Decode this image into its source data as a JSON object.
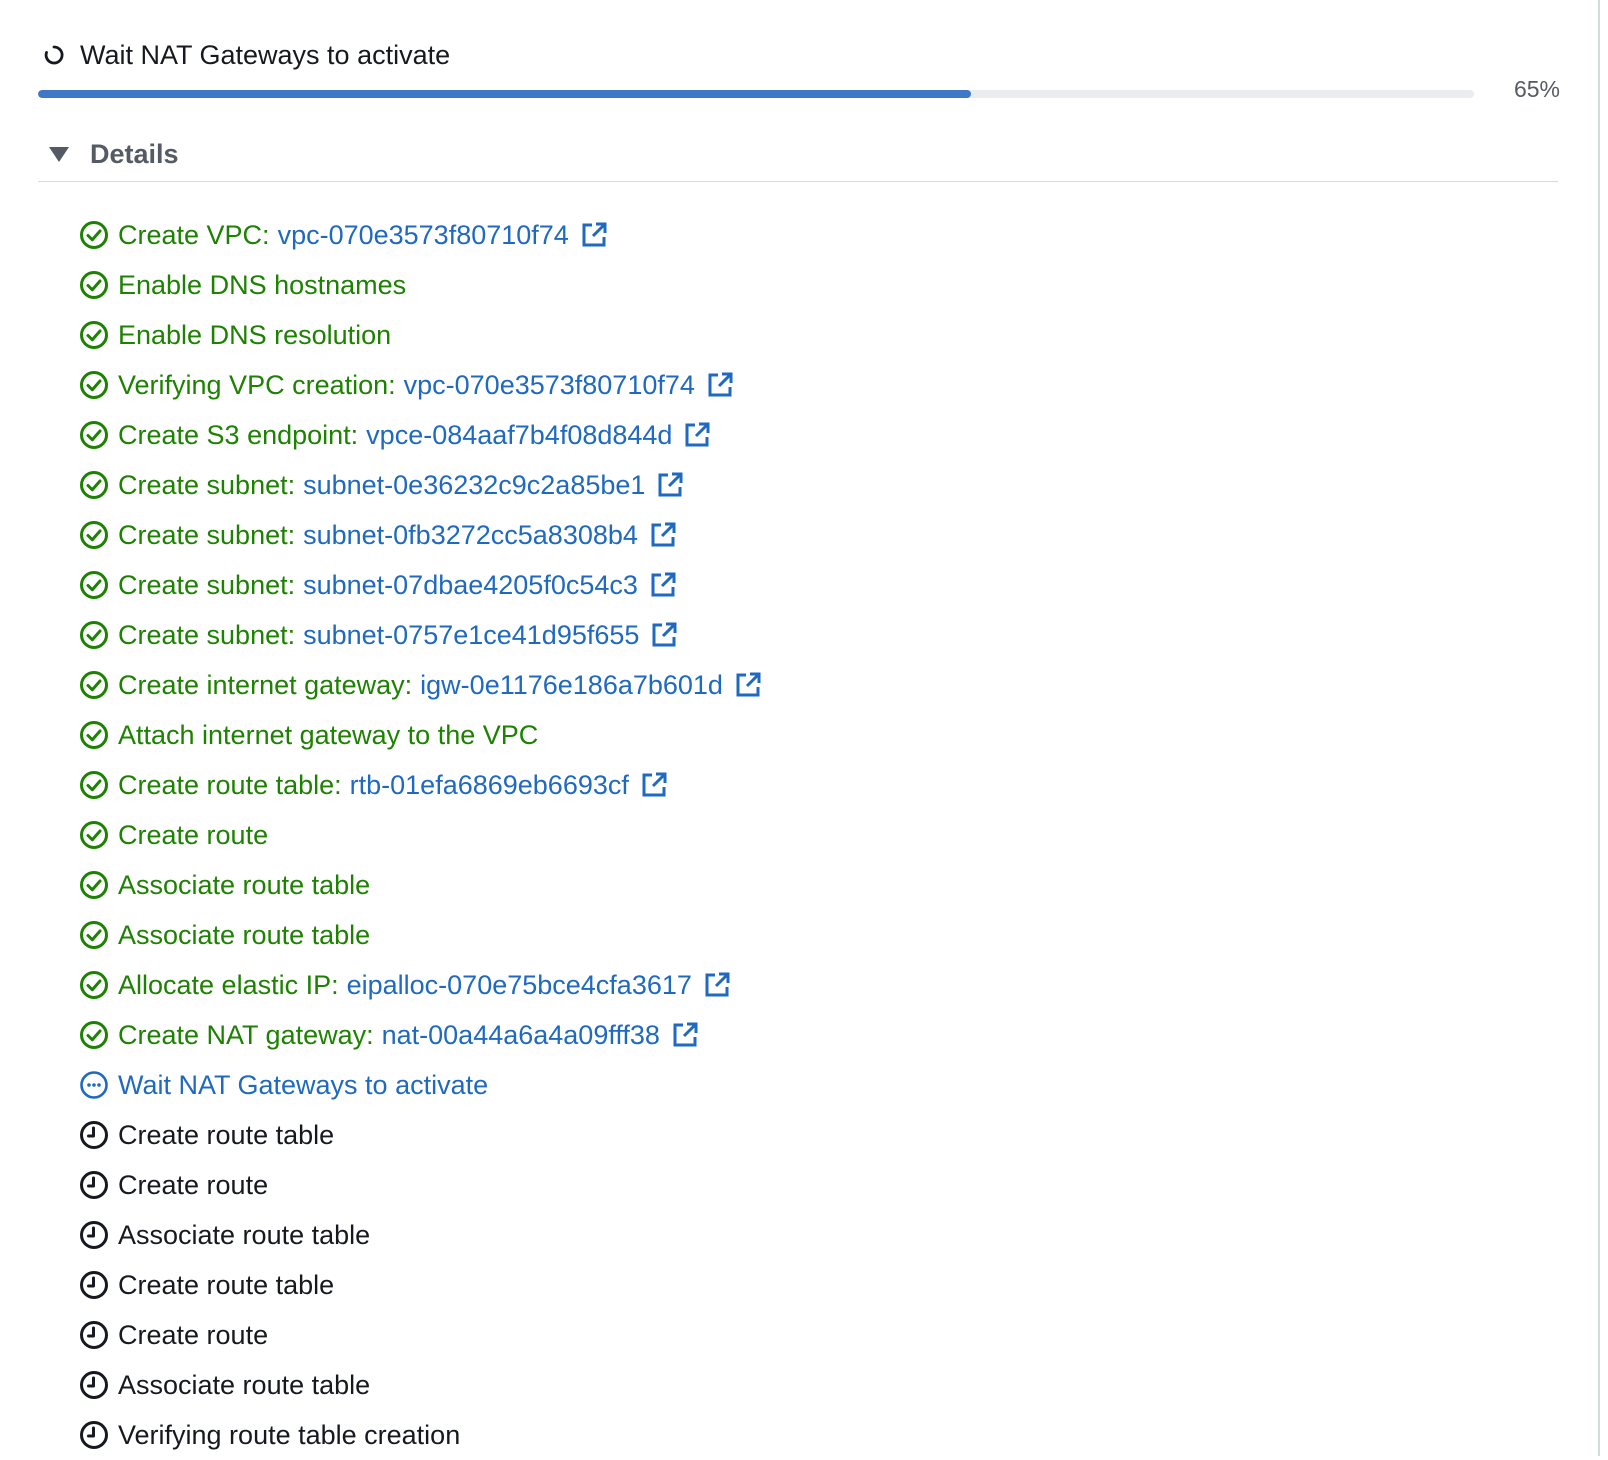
{
  "header": {
    "title": "Wait NAT Gateways to activate",
    "progress_percent": 65,
    "progress_label": "65%"
  },
  "details": {
    "label": "Details",
    "expanded": true
  },
  "colors": {
    "success": "#1d8102",
    "link": "#1f69c1",
    "pending": "#16191f",
    "progress_fill": "#3f78c4",
    "progress_track": "#eaeded"
  },
  "steps": [
    {
      "status": "success",
      "label": "Create VPC:",
      "link": "vpc-070e3573f80710f74"
    },
    {
      "status": "success",
      "label": "Enable DNS hostnames",
      "link": ""
    },
    {
      "status": "success",
      "label": "Enable DNS resolution",
      "link": ""
    },
    {
      "status": "success",
      "label": "Verifying VPC creation:",
      "link": "vpc-070e3573f80710f74"
    },
    {
      "status": "success",
      "label": "Create S3 endpoint:",
      "link": "vpce-084aaf7b4f08d844d"
    },
    {
      "status": "success",
      "label": "Create subnet:",
      "link": "subnet-0e36232c9c2a85be1"
    },
    {
      "status": "success",
      "label": "Create subnet:",
      "link": "subnet-0fb3272cc5a8308b4"
    },
    {
      "status": "success",
      "label": "Create subnet:",
      "link": "subnet-07dbae4205f0c54c3"
    },
    {
      "status": "success",
      "label": "Create subnet:",
      "link": "subnet-0757e1ce41d95f655"
    },
    {
      "status": "success",
      "label": "Create internet gateway:",
      "link": "igw-0e1176e186a7b601d"
    },
    {
      "status": "success",
      "label": "Attach internet gateway to the VPC",
      "link": ""
    },
    {
      "status": "success",
      "label": "Create route table:",
      "link": "rtb-01efa6869eb6693cf"
    },
    {
      "status": "success",
      "label": "Create route",
      "link": ""
    },
    {
      "status": "success",
      "label": "Associate route table",
      "link": ""
    },
    {
      "status": "success",
      "label": "Associate route table",
      "link": ""
    },
    {
      "status": "success",
      "label": "Allocate elastic IP:",
      "link": "eipalloc-070e75bce4cfa3617"
    },
    {
      "status": "success",
      "label": "Create NAT gateway:",
      "link": "nat-00a44a6a4a09fff38"
    },
    {
      "status": "inprogress",
      "label": "Wait NAT Gateways to activate",
      "link": ""
    },
    {
      "status": "pending",
      "label": "Create route table",
      "link": ""
    },
    {
      "status": "pending",
      "label": "Create route",
      "link": ""
    },
    {
      "status": "pending",
      "label": "Associate route table",
      "link": ""
    },
    {
      "status": "pending",
      "label": "Create route table",
      "link": ""
    },
    {
      "status": "pending",
      "label": "Create route",
      "link": ""
    },
    {
      "status": "pending",
      "label": "Associate route table",
      "link": ""
    },
    {
      "status": "pending",
      "label": "Verifying route table creation",
      "link": ""
    }
  ]
}
